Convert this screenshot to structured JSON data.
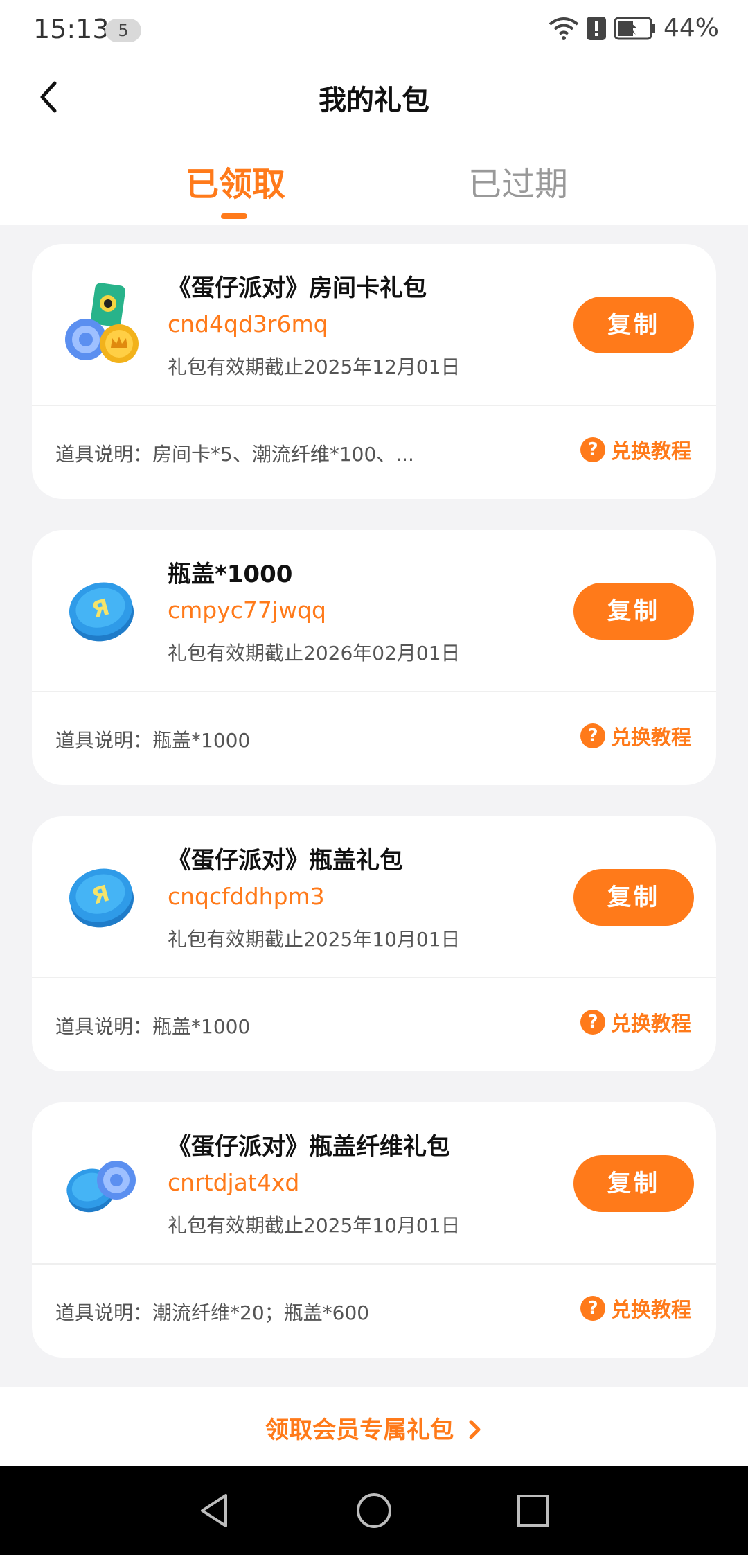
{
  "status_bar": {
    "time": "15:13",
    "notification_count": "5",
    "battery": "44%"
  },
  "header": {
    "title": "我的礼包",
    "tabs": [
      {
        "label": "已领取",
        "active": true
      },
      {
        "label": "已过期",
        "active": false
      }
    ]
  },
  "cards": [
    {
      "icon": "room-card-coin-icon",
      "title": "《蛋仔派对》房间卡礼包",
      "code": "cnd4qd3r6mq",
      "expiry": "礼包有效期截止2025年12月01日",
      "copy_label": "复制",
      "description": "道具说明：房间卡*5、潮流纤维*100、...",
      "guide_label": "兑换教程"
    },
    {
      "icon": "bottle-cap-icon",
      "title": "瓶盖*1000",
      "code": "cmpyc77jwqq",
      "expiry": "礼包有效期截止2026年02月01日",
      "copy_label": "复制",
      "description": "道具说明：瓶盖*1000",
      "guide_label": "兑换教程"
    },
    {
      "icon": "bottle-cap-icon",
      "title": "《蛋仔派对》瓶盖礼包",
      "code": "cnqcfddhpm3",
      "expiry": "礼包有效期截止2025年10月01日",
      "copy_label": "复制",
      "description": "道具说明：瓶盖*1000",
      "guide_label": "兑换教程"
    },
    {
      "icon": "bottle-cap-fiber-icon",
      "title": "《蛋仔派对》瓶盖纤维礼包",
      "code": "cnrtdjat4xd",
      "expiry": "礼包有效期截止2025年10月01日",
      "copy_label": "复制",
      "description": "道具说明：潮流纤维*20；瓶盖*600",
      "guide_label": "兑换教程"
    }
  ],
  "footer": {
    "vip_link": "领取会员专属礼包"
  },
  "colors": {
    "accent": "#ff7a1a",
    "cap_blue": "#2f9be8"
  }
}
